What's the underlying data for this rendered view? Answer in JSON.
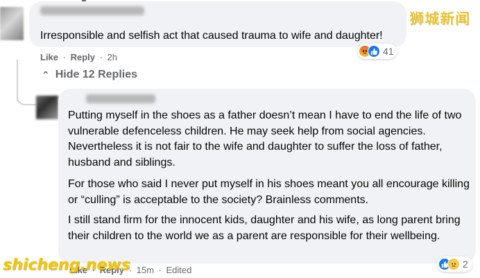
{
  "comment": {
    "text": "Irresponsible and selfish act that caused trauma to wife and daughter!",
    "like_label": "Like",
    "reply_label": "Reply",
    "separator": "·",
    "time": "2h",
    "reaction_count": "41",
    "reaction_icons": [
      "angry-icon",
      "like-icon"
    ]
  },
  "replies_toggle": {
    "chevron": "⌃",
    "label": "Hide 12 Replies"
  },
  "reply": {
    "paragraphs": [
      "Putting myself in the shoes as a father doesn’t mean I have to end the life of two vulnerable defenceless children. He may seek help from social agencies. Nevertheless it is not fair to the wife and daughter to suffer the loss of father, husband and siblings.",
      "For those who said I never put myself in his shoes meant you all encourage killing or “culling” is acceptable to the society? Brainless comments.",
      "I still stand firm for the innocent kids, daughter and his wife, as long parent bring their children to the world we as a parent are responsible for their wellbeing."
    ],
    "like_label": "Like",
    "reply_label": "Reply",
    "separator": "·",
    "time": "15m",
    "edited_label": "Edited",
    "reaction_count": "2",
    "reaction_icons": [
      "like-icon",
      "sad-icon"
    ]
  },
  "watermarks": {
    "top": "狮城新闻",
    "bottom": "shicheng.news"
  },
  "colors": {
    "bubble": "#f0f2f5",
    "meta_text": "#65676b",
    "like_blue": "#1877f2",
    "watermark_yellow": "#f4c500"
  }
}
